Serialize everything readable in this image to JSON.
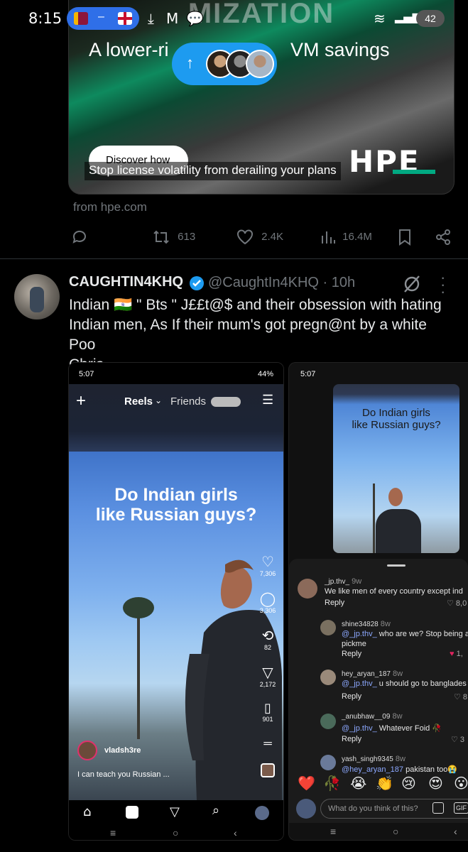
{
  "status_bar": {
    "time": "8:15",
    "battery": "42"
  },
  "ad": {
    "background_text": "MIZATION",
    "headline_left": "A lower-ri",
    "headline_right": "VM savings",
    "cta": "Discover how",
    "caption": "Stop license volatility from derailing your plans",
    "logo": "HPE",
    "source": "from hpe.com"
  },
  "ad_actions": {
    "reposts": "613",
    "likes": "2.4K",
    "views": "16.4M"
  },
  "tweet": {
    "author_name": "CAUGHTIN4KHQ",
    "handle_time": "@CaughtIn4KHQ · 10h",
    "text_line1": "Indian 🇮🇳 \" Bts \" J££t@$ and their obsession with hating",
    "text_line2": "Indian men, As If their mum's got pregn@nt by a white Poo",
    "text_line3": "Chris."
  },
  "screenshot1": {
    "status_time": "5:07",
    "status_right": "44%",
    "tab_reels": "Reels",
    "tab_friends": "Friends",
    "question_line1": "Do Indian girls",
    "question_line2": "like Russian guys?",
    "likes": "7,306",
    "comments": "3,306",
    "reposts": "82",
    "shares": "2,172",
    "saves": "901",
    "username": "vladsh3re",
    "caption": "I can teach you Russian ..."
  },
  "screenshot2": {
    "status_time": "5:07",
    "question_line1": "Do Indian girls",
    "question_line2": "like Russian guys?",
    "comments": [
      {
        "user": "_jp.thv_",
        "age": "9w",
        "mention": "",
        "text": "We like men of every country except ind",
        "reply": "Reply",
        "likes": "8,0"
      },
      {
        "user": "shine34828",
        "age": "8w",
        "mention": "@_jp.thv_",
        "text": "who are we? Stop being a",
        "text2": "pickme",
        "reply": "Reply",
        "likes": "1,"
      },
      {
        "user": "hey_aryan_187",
        "age": "8w",
        "mention": "@_jp.thv_",
        "text": "u should go to banglades",
        "reply": "Reply",
        "likes": "8"
      },
      {
        "user": "_anubhaw__09",
        "age": "8w",
        "mention": "@_jp.thv_",
        "text": "Whatever Foid 🥀",
        "reply": "Reply",
        "likes": "3"
      },
      {
        "user": "yash_singh9345",
        "age": "8w",
        "mention": "@hey_aryan_187",
        "text": "pakistan too😭",
        "reply": "",
        "likes": ""
      }
    ],
    "emojis": [
      "❤️",
      "🥀",
      "😭",
      "👏",
      "😢",
      "😍",
      "😮"
    ],
    "input_placeholder": "What do you think of this?"
  }
}
